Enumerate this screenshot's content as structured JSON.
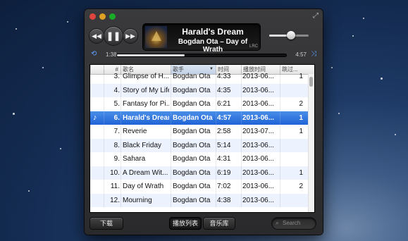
{
  "now_playing": {
    "title": "Harald's Dream",
    "subtitle": "Bogdan Ota – Day of Wrath",
    "lrc_label": "LRC",
    "elapsed": "1:38",
    "remaining": "4:57",
    "progress_fraction": 0.4,
    "volume_fraction": 0.55
  },
  "controls": {
    "prev_icon": "rewind-icon",
    "play_icon": "pause-icon",
    "next_icon": "fast-forward-icon",
    "repeat_icon": "repeat-icon",
    "shuffle_icon": "shuffle-icon"
  },
  "columns": {
    "number": "#",
    "title": "歌名",
    "artist": "歌手",
    "time": "时间",
    "play_time": "播放时间",
    "skips": "跳过..."
  },
  "tracks": [
    {
      "number": "3.",
      "title": "Glimpse of H...",
      "artist": "Bogdan Ota",
      "time": "4:33",
      "date": "2013-06...",
      "skips": "1"
    },
    {
      "number": "4.",
      "title": "Story of My Life",
      "artist": "Bogdan Ota",
      "time": "4:35",
      "date": "2013-06...",
      "skips": ""
    },
    {
      "number": "5.",
      "title": "Fantasy for Pi...",
      "artist": "Bogdan Ota",
      "time": "6:21",
      "date": "2013-06...",
      "skips": "2"
    },
    {
      "number": "6.",
      "title": "Harald's Dream",
      "artist": "Bogdan Ota",
      "time": "4:57",
      "date": "2013-06...",
      "skips": "1",
      "playing": true
    },
    {
      "number": "7.",
      "title": "Reverie",
      "artist": "Bogdan Ota",
      "time": "2:58",
      "date": "2013-07...",
      "skips": "1"
    },
    {
      "number": "8.",
      "title": "Black Friday",
      "artist": "Bogdan Ota",
      "time": "5:14",
      "date": "2013-06...",
      "skips": ""
    },
    {
      "number": "9.",
      "title": "Sahara",
      "artist": "Bogdan Ota",
      "time": "4:31",
      "date": "2013-06...",
      "skips": ""
    },
    {
      "number": "10.",
      "title": "A Dream Wit...",
      "artist": "Bogdan Ota",
      "time": "6:19",
      "date": "2013-06...",
      "skips": "1"
    },
    {
      "number": "11.",
      "title": "Day of Wrath",
      "artist": "Bogdan Ota",
      "time": "7:02",
      "date": "2013-06...",
      "skips": "2"
    },
    {
      "number": "12.",
      "title": "Mourning",
      "artist": "Bogdan Ota",
      "time": "4:38",
      "date": "2013-06...",
      "skips": ""
    }
  ],
  "bottom_bar": {
    "download": "下载",
    "playlist": "播放列表",
    "library": "音乐库",
    "search_placeholder": "Search"
  }
}
